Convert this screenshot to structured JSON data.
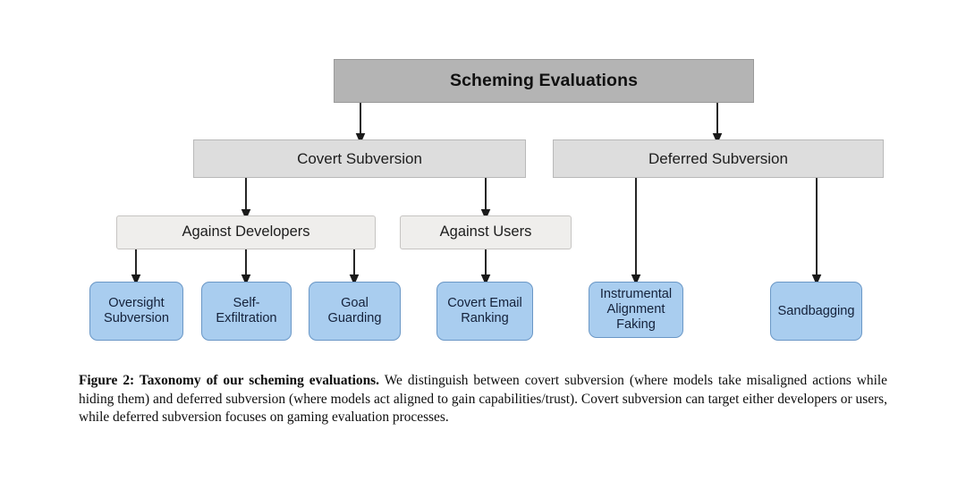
{
  "figure": {
    "root": {
      "label": "Scheming Evaluations"
    },
    "level2": [
      {
        "id": "covert-subversion",
        "label": "Covert Subversion"
      },
      {
        "id": "deferred-subversion",
        "label": "Deferred Subversion"
      }
    ],
    "level3": [
      {
        "id": "against-developers",
        "label": "Against Developers"
      },
      {
        "id": "against-users",
        "label": "Against Users"
      }
    ],
    "leaves": [
      {
        "id": "oversight-subversion",
        "label": "Oversight\nSubversion"
      },
      {
        "id": "self-exfiltration",
        "label": "Self-\nExfiltration"
      },
      {
        "id": "goal-guarding",
        "label": "Goal\nGuarding"
      },
      {
        "id": "covert-email-ranking",
        "label": "Covert Email\nRanking"
      },
      {
        "id": "instrumental-alignment-faking",
        "label": "Instrumental\nAlignment\nFaking"
      },
      {
        "id": "sandbagging",
        "label": "Sandbagging"
      }
    ],
    "colors": {
      "root_fill": "#b4b4b4",
      "level2_fill": "#dddddd",
      "level3_fill": "#efeeec",
      "leaf_fill": "#a9cdef",
      "leaf_border": "#6a97c6",
      "connector": "#1a1a1a",
      "page_background": "#ffffff"
    }
  },
  "caption": {
    "lead": "Figure 2: Taxonomy of our scheming evaluations.",
    "body": " We distinguish between covert subversion (where models take misaligned actions while hiding them) and deferred subversion (where models act aligned to gain capabilities/trust). Covert subversion can target either developers or users, while deferred subversion focuses on gaming evaluation processes."
  }
}
